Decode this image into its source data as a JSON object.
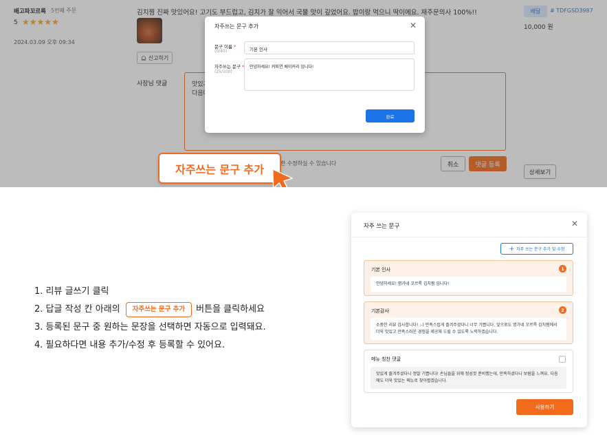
{
  "review": {
    "store_name": "배고파꼬르륵",
    "order_count": "5번째 주문",
    "rating": "5",
    "stars": "★★★★★",
    "date": "2024.03.09 오후 09:34",
    "text": "김치찜 진짜 맛있어요! 고기도 부드럽고, 김치가 잘 익어서 국물 맛이 깊었어요. 밥이랑 먹으니 딱이에요. 재주문의사 100%!!",
    "report_label": "신고하기",
    "owner_reply_label": "사장님 댓글",
    "reply_text_line1": "맛있게",
    "reply_text_line2": "다음에",
    "edit_note": "한 수정하실 수 있습니다",
    "cancel_label": "취소",
    "submit_label": "댓글 등록",
    "delivery_badge": "배달",
    "order_number": "# TDFGSD3987",
    "price": "10,000 원",
    "detail_label": "상세보기"
  },
  "add_phrase_modal": {
    "title": "자주쓰는 문구 추가",
    "name_label": "문구 이름",
    "name_count": "(0/40)",
    "name_value": "기본 인사",
    "phrase_label": "자주쓰는 문구",
    "phrase_count": "(25/100)",
    "phrase_value": "안녕하세요! 커피연 베이커리 입니다!",
    "confirm_label": "완료"
  },
  "callout_label": "자주쓰는 문구 추가",
  "steps": {
    "s1": "1. 리뷰 글쓰기 클릭",
    "s2_before": "2.  답글 작성 칸 아래의",
    "s2_button": "자주쓰는 문구 추가",
    "s2_after": "버튼을 클릭하세요",
    "s3": "3. 등록된 문구 중 원하는 문장을 선택하면 자동으로 입력돼요.",
    "s4": "4. 필요하다면 내용 추가/수정 후 등록할 수 있어요."
  },
  "phrases_modal": {
    "title": "자주 쓰는 문구",
    "add_edit_label": "자주 쓰는 문구 추가 및 수정",
    "use_label": "사용하기",
    "cards": [
      {
        "title": "기본 인사",
        "badge": "1",
        "body": "안녕하세요! 명가네 꼬르륵 김치찜 입니다!"
      },
      {
        "title": "기본감사",
        "badge": "2",
        "body": "소중한 리뷰 감사합니다! :-) 만족스럽게 즐겨주셨다니 너무 기쁩니다. 앞으로도 명가네 꼬르륵 김치찜에서 더욱 맛있고 만족스러운 경험을 제공해 드릴 수 있도록 노력하겠습니다."
      },
      {
        "title": "메뉴 칭찬 댓글",
        "badge": "",
        "body": "맛있게 즐겨주셨다니 정말 기쁩니다! 손님들을 위해 정성껏 준비했는데, 만족하셨다니 보람을 느껴요. 다음에도 더욱 맛있는 메뉴로 찾아뵙겠습니다."
      }
    ]
  },
  "colors": {
    "accent": "#f26b1d",
    "blue": "#1a73e8",
    "star": "#f5a623"
  }
}
